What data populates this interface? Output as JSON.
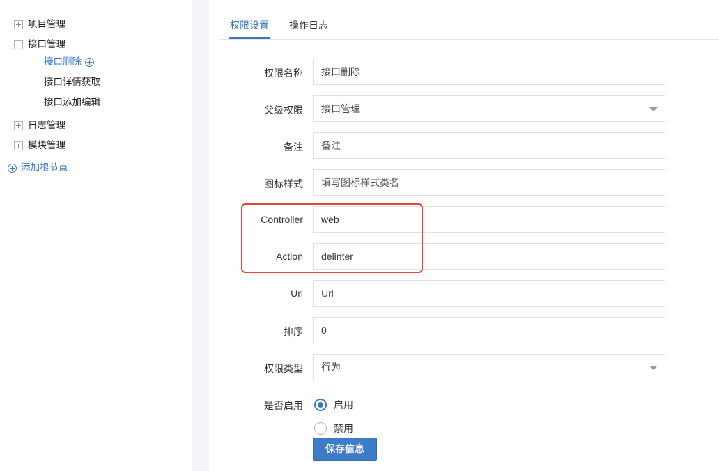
{
  "tree": {
    "nodes": [
      {
        "label": "项目管理",
        "state": "collapsed"
      },
      {
        "label": "接口管理",
        "state": "expanded"
      },
      {
        "label": "日志管理",
        "state": "collapsed"
      },
      {
        "label": "模块管理",
        "state": "collapsed"
      }
    ],
    "children": [
      {
        "label": "接口删除",
        "selected": true
      },
      {
        "label": "接口详情获取"
      },
      {
        "label": "接口添加编辑"
      }
    ],
    "add_root_label": "添加根节点"
  },
  "tabs": [
    {
      "label": "权限设置",
      "active": true
    },
    {
      "label": "操作日志",
      "active": false
    }
  ],
  "form": {
    "name": {
      "label": "权限名称",
      "value": "接口删除"
    },
    "parent": {
      "label": "父级权限",
      "value": "接口管理"
    },
    "remark": {
      "label": "备注",
      "placeholder": "备注"
    },
    "icon_style": {
      "label": "图标样式",
      "placeholder": "填写图标样式类名"
    },
    "controller": {
      "label": "Controller",
      "value": "web"
    },
    "action": {
      "label": "Action",
      "value": "delinter"
    },
    "url": {
      "label": "Url",
      "placeholder": "Url"
    },
    "sort": {
      "label": "排序",
      "value": "0"
    },
    "type": {
      "label": "权限类型",
      "value": "行为"
    },
    "enabled": {
      "label": "是否启用",
      "options": [
        {
          "label": "启用",
          "checked": true
        },
        {
          "label": "禁用",
          "checked": false
        }
      ]
    },
    "save_label": "保存信息"
  },
  "colors": {
    "accent": "#3a78c2",
    "highlight_box": "#e0483a",
    "gutter": "#f3f4f7"
  }
}
